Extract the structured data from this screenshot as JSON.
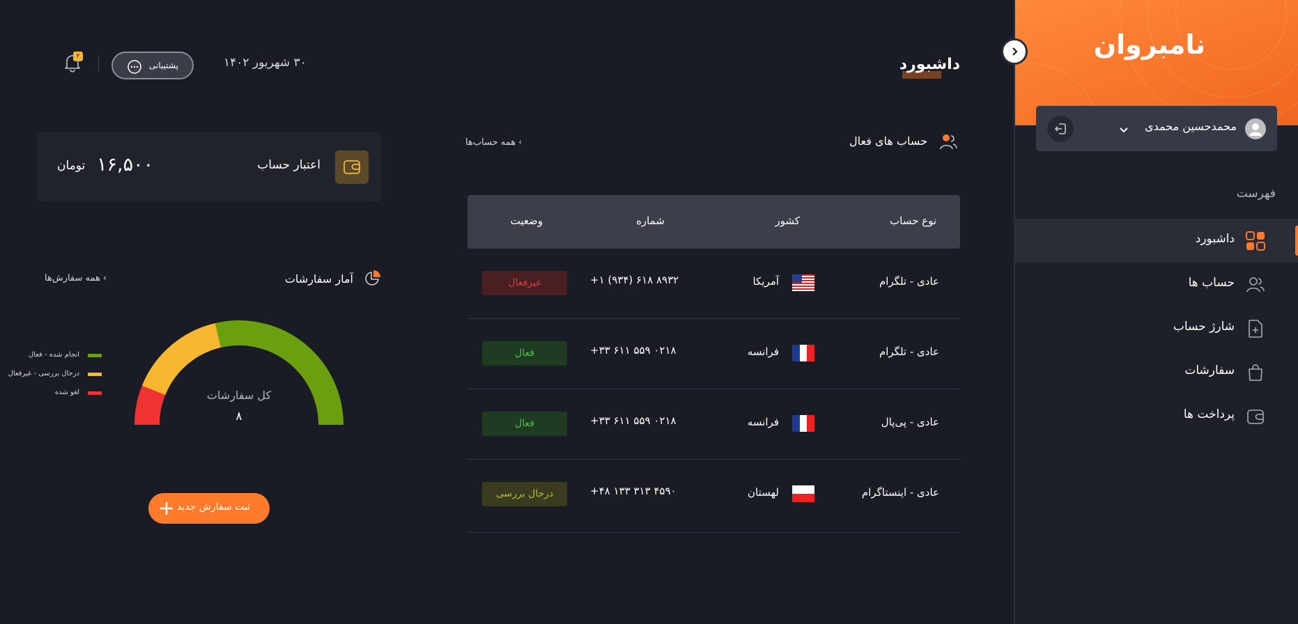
{
  "colors": {
    "accent": "#ff7a2a",
    "background": "#1a1c25",
    "status_inactive_bg": "#4a1f22",
    "status_inactive_text": "#e03a3a",
    "status_active_bg": "#1f3b22",
    "status_active_text": "#46c246",
    "status_review_bg": "#3b3b1f",
    "status_review_text": "#b9b53c"
  },
  "sidebar": {
    "logo": "نامبروان",
    "user": {
      "name": "محمدحسین محمدی",
      "avatar_icon": "user-icon"
    },
    "menu_title": "فهرست",
    "items": [
      {
        "label": "داشبورد",
        "icon": "grid-icon",
        "active": true
      },
      {
        "label": "حساب ها",
        "icon": "users-icon",
        "active": false
      },
      {
        "label": "شارژ حساب",
        "icon": "file-plus-icon",
        "active": false
      },
      {
        "label": "سفارشات",
        "icon": "bag-icon",
        "active": false
      },
      {
        "label": "پرداخت ها",
        "icon": "wallet-icon",
        "active": false
      }
    ]
  },
  "header": {
    "title": "داشبورد",
    "date": "۳۰ شهریور ۱۴۰۲",
    "support_label": "پشتیبانی",
    "notification_count": "۲"
  },
  "credit": {
    "label": "اعتبار حساب",
    "amount": "۱۶,۵۰۰",
    "unit": "تومان"
  },
  "orders": {
    "title": "آمار سفارشات",
    "view_all": "همه سفارش‌ها",
    "total_label": "کل سفارشات",
    "total_value": "۸",
    "legend": [
      {
        "label": "انجام شده - فعال",
        "color": "#6aa00f"
      },
      {
        "label": "درحال بررسی - غیرفعال",
        "color": "#f7b731"
      },
      {
        "label": "لغو شده",
        "color": "#f03232"
      }
    ],
    "new_order_label": "ثبت سفارش جدید"
  },
  "accounts": {
    "title": "حساب های فعال",
    "view_all": "همه حساب‌ها",
    "columns": [
      "نوع حساب",
      "کشور",
      "شماره",
      "وضعیت"
    ],
    "rows": [
      {
        "type": "عادی - تلگرام",
        "flag": "us",
        "country": "آمریکا",
        "number": "+۱ (۹۳۴) ۶۱۸ ۸۹۳۲",
        "status": "غیرفعال",
        "status_kind": "inactive"
      },
      {
        "type": "عادی - تلگرام",
        "flag": "fr",
        "country": "فرانسه",
        "number": "+۳۳ ۶۱۱ ۵۵۹ ۰۲۱۸",
        "status": "فعال",
        "status_kind": "active"
      },
      {
        "type": "عادی - پی‌پال",
        "flag": "fr",
        "country": "فرانسه",
        "number": "+۳۳ ۶۱۱ ۵۵۹ ۰۲۱۸",
        "status": "فعال",
        "status_kind": "active"
      },
      {
        "type": "عادی - اینستاگرام",
        "flag": "pl",
        "country": "لهستان",
        "number": "+۴۸ ۱۳۳ ۳۱۳ ۴۵۹۰",
        "status": "درحال بررسی",
        "status_kind": "review"
      }
    ]
  }
}
